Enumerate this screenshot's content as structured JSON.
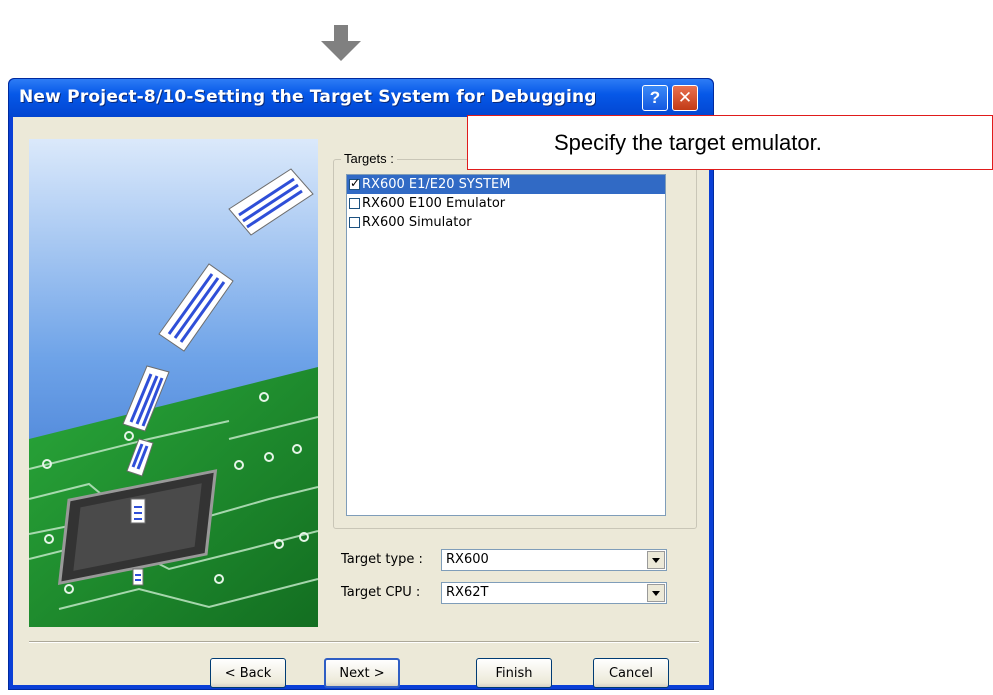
{
  "window": {
    "title": "New Project-8/10-Setting the Target System for Debugging",
    "help_glyph": "?",
    "close_glyph": "✕"
  },
  "targets": {
    "label": "Targets :",
    "items": [
      {
        "label": "RX600 E1/E20 SYSTEM",
        "checked": true,
        "selected": true
      },
      {
        "label": "RX600 E100 Emulator",
        "checked": false,
        "selected": false
      },
      {
        "label": "RX600 Simulator",
        "checked": false,
        "selected": false
      }
    ]
  },
  "target_type": {
    "label": "Target type :",
    "value": "RX600"
  },
  "target_cpu": {
    "label": "Target CPU :",
    "value": "RX62T"
  },
  "buttons": {
    "back": "< Back",
    "next": "Next >",
    "finish": "Finish",
    "cancel": "Cancel"
  },
  "callout": {
    "text": "Specify the target emulator."
  },
  "icons": {
    "arrow": "down-arrow-icon",
    "help": "help-icon",
    "close": "close-icon",
    "dropdown": "chevron-down-icon"
  },
  "colors": {
    "titlebar": "#0a3fd6",
    "selection": "#316ac5",
    "callout_border": "#e01b1b",
    "arrow": "#808080"
  }
}
